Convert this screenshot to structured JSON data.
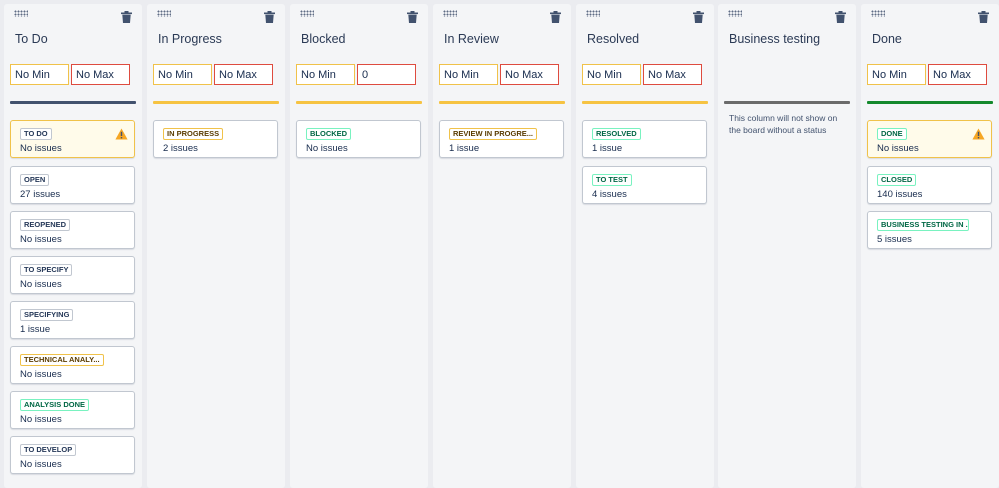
{
  "colors": {
    "blue": "#42526e",
    "yellow": "#f6c342",
    "gray": "#6b6b6b",
    "green": "#14892c"
  },
  "columns": [
    {
      "title": "To Do",
      "min_placeholder": "No Min",
      "max_placeholder": "No Max",
      "min_value": "",
      "max_value": "",
      "color": "blue",
      "cards": [
        {
          "status": "TO DO",
          "count": "No issues",
          "tone": "blue",
          "warning": true
        },
        {
          "status": "OPEN",
          "count": "27 issues",
          "tone": "blue",
          "warning": false
        },
        {
          "status": "REOPENED",
          "count": "No issues",
          "tone": "blue",
          "warning": false
        },
        {
          "status": "TO SPECIFY",
          "count": "No issues",
          "tone": "blue",
          "warning": false
        },
        {
          "status": "SPECIFYING",
          "count": "1 issue",
          "tone": "blue",
          "warning": false
        },
        {
          "status": "TECHNICAL ANALY...",
          "count": "No issues",
          "tone": "yellow",
          "warning": false
        },
        {
          "status": "ANALYSIS DONE",
          "count": "No issues",
          "tone": "green",
          "warning": false
        },
        {
          "status": "TO DEVELOP",
          "count": "No issues",
          "tone": "blue",
          "warning": false
        }
      ]
    },
    {
      "title": "In Progress",
      "min_placeholder": "No Min",
      "max_placeholder": "No Max",
      "min_value": "",
      "max_value": "",
      "color": "yellow",
      "cards": [
        {
          "status": "IN PROGRESS",
          "count": "2 issues",
          "tone": "yellow",
          "warning": false
        }
      ]
    },
    {
      "title": "Blocked",
      "min_placeholder": "No Min",
      "max_placeholder": "No Max",
      "min_value": "",
      "max_value": "0",
      "color": "yellow",
      "cards": [
        {
          "status": "BLOCKED",
          "count": "No issues",
          "tone": "green",
          "warning": false
        }
      ]
    },
    {
      "title": "In Review",
      "min_placeholder": "No Min",
      "max_placeholder": "No Max",
      "min_value": "",
      "max_value": "",
      "color": "yellow",
      "cards": [
        {
          "status": "REVIEW IN PROGRE...",
          "count": "1 issue",
          "tone": "yellow",
          "warning": false
        }
      ]
    },
    {
      "title": "Resolved",
      "min_placeholder": "No Min",
      "max_placeholder": "No Max",
      "min_value": "",
      "max_value": "",
      "color": "yellow",
      "cards": [
        {
          "status": "RESOLVED",
          "count": "1 issue",
          "tone": "green",
          "warning": false
        },
        {
          "status": "TO TEST",
          "count": "4 issues",
          "tone": "green",
          "warning": false
        }
      ]
    },
    {
      "title": "Business testing",
      "note": "This column will not show on the board without a status",
      "color": "gray",
      "cards": []
    },
    {
      "title": "Done",
      "min_placeholder": "No Min",
      "max_placeholder": "No Max",
      "min_value": "",
      "max_value": "",
      "color": "green",
      "cards": [
        {
          "status": "DONE",
          "count": "No issues",
          "tone": "green",
          "warning": true
        },
        {
          "status": "CLOSED",
          "count": "140 issues",
          "tone": "green",
          "warning": false
        },
        {
          "status": "BUSINESS TESTING IN ...",
          "count": "5 issues",
          "tone": "green",
          "warning": false
        }
      ]
    }
  ]
}
